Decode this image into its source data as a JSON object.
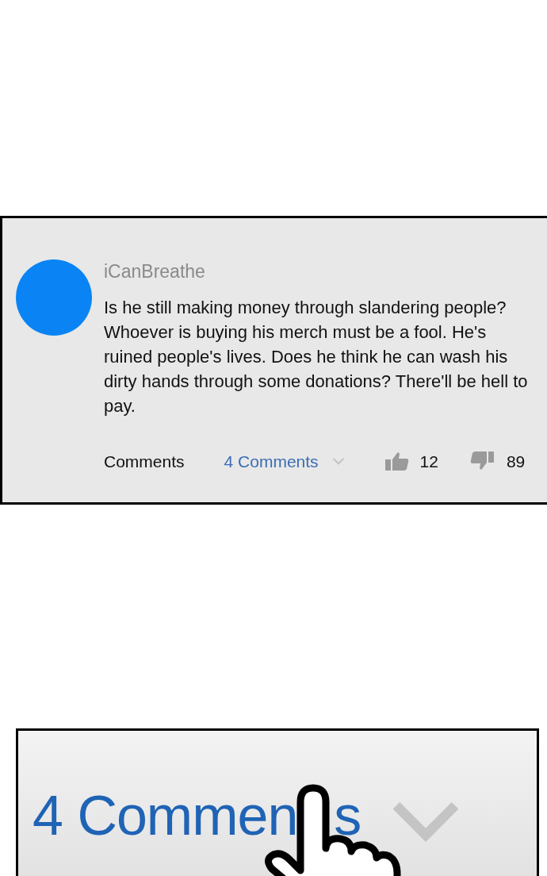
{
  "comment": {
    "author": "iCanBreathe",
    "text": "Is he still making money through slandering people? Whoever is buying his merch must be a fool. He's ruined people's lives. Does he think he can wash his dirty hands through some donations? There'll be hell to pay.",
    "footer": {
      "comments_label": "Comments",
      "replies_link": "4 Comments",
      "likes": "12",
      "dislikes": "89"
    }
  },
  "closeup": {
    "replies_link_visible": "4 Commen",
    "replies_link_tail": "s"
  }
}
